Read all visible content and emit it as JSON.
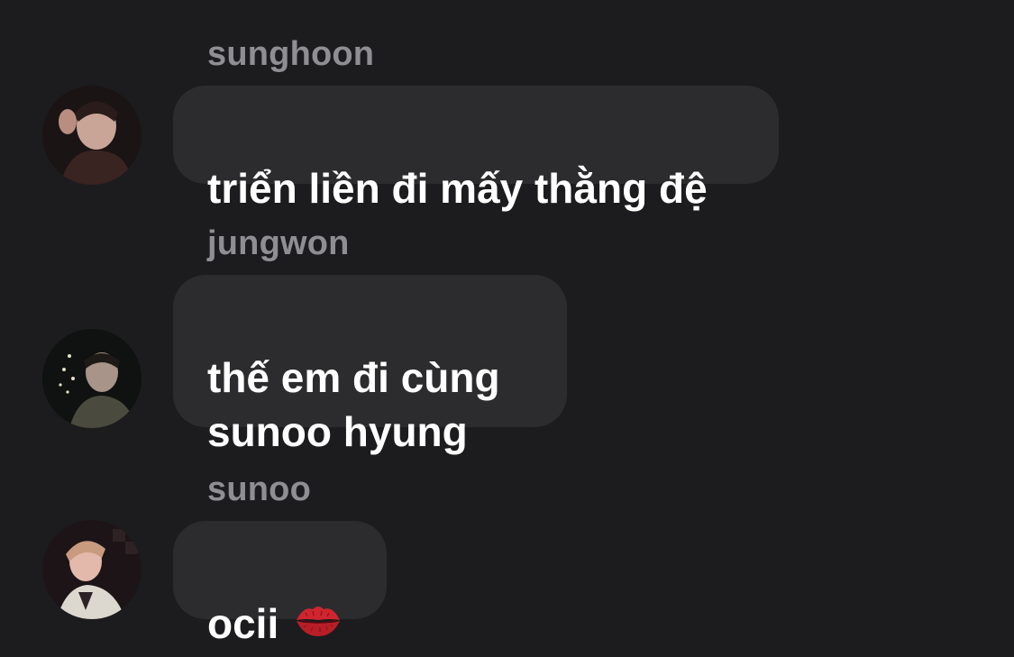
{
  "messages": [
    {
      "sender": "sunghoon",
      "text": "triển liền đi mấy thằng đệ",
      "avatar_icon": "avatar-sunghoon"
    },
    {
      "sender": "jungwon",
      "text": "thế em đi cùng\nsunoo hyung",
      "avatar_icon": "avatar-jungwon"
    },
    {
      "sender": "sunoo",
      "text": "ocii",
      "emoji": "kiss-mark-icon",
      "avatar_icon": "avatar-sunoo"
    }
  ],
  "colors": {
    "background": "#1c1c1e",
    "bubble": "#2c2c2e",
    "sender_name": "#8e8e93",
    "message_text": "#ffffff",
    "kiss_mark": "#d0252e"
  }
}
